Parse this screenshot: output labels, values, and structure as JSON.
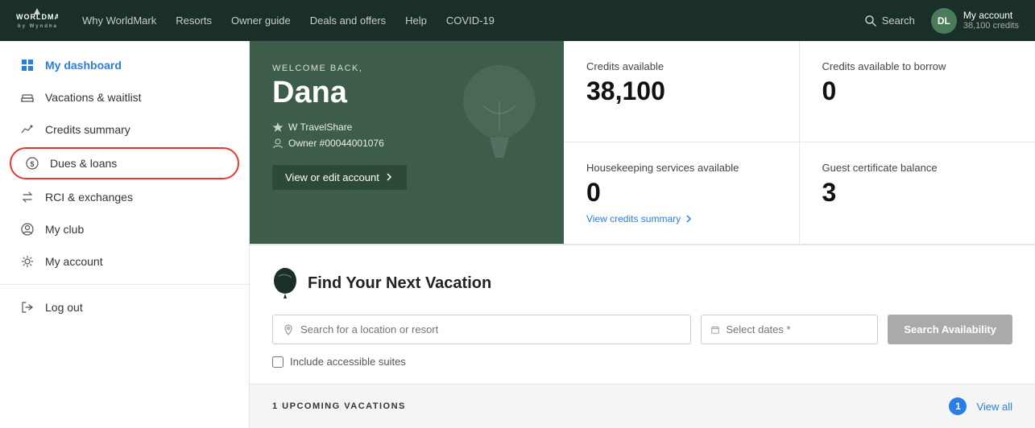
{
  "nav": {
    "logo_mark": "WORLDMARK",
    "logo_sub": "by Wyndham",
    "links": [
      "Why WorldMark",
      "Resorts",
      "Owner guide",
      "Deals and offers",
      "Help",
      "COVID-19"
    ],
    "search_label": "Search",
    "account_initials": "DL",
    "account_name": "My account",
    "account_credits": "38,100 credits"
  },
  "sidebar": {
    "items": [
      {
        "id": "my-dashboard",
        "label": "My dashboard",
        "icon": "grid"
      },
      {
        "id": "vacations-waitlist",
        "label": "Vacations & waitlist",
        "icon": "bed"
      },
      {
        "id": "credits-summary",
        "label": "Credits summary",
        "icon": "chart"
      },
      {
        "id": "dues-loans",
        "label": "Dues & loans",
        "icon": "dollar",
        "highlighted": true
      },
      {
        "id": "rci-exchanges",
        "label": "RCI & exchanges",
        "icon": "arrows"
      },
      {
        "id": "my-club",
        "label": "My club",
        "icon": "user-circle"
      },
      {
        "id": "my-account",
        "label": "My account",
        "icon": "gear"
      }
    ],
    "log_out_label": "Log out"
  },
  "welcome": {
    "greeting": "WELCOME BACK,",
    "name": "Dana",
    "travel_share": "W TravelShare",
    "owner_number": "Owner #00044001076",
    "edit_btn": "View or edit account"
  },
  "stats": {
    "credits_available_label": "Credits available",
    "credits_available_value": "38,100",
    "credits_borrow_label": "Credits available to borrow",
    "credits_borrow_value": "0",
    "housekeeping_label": "Housekeeping services available",
    "housekeeping_value": "0",
    "guest_cert_label": "Guest certificate balance",
    "guest_cert_value": "3",
    "credits_link": "View credits summary"
  },
  "vacation_search": {
    "title": "Find Your Next Vacation",
    "location_placeholder": "Search for a location or resort",
    "dates_placeholder": "Select dates *",
    "search_btn": "Search Availability",
    "accessible_label": "Include accessible suites"
  },
  "upcoming": {
    "label": "1 UPCOMING VACATIONS",
    "count": "1",
    "view_all": "View all"
  }
}
